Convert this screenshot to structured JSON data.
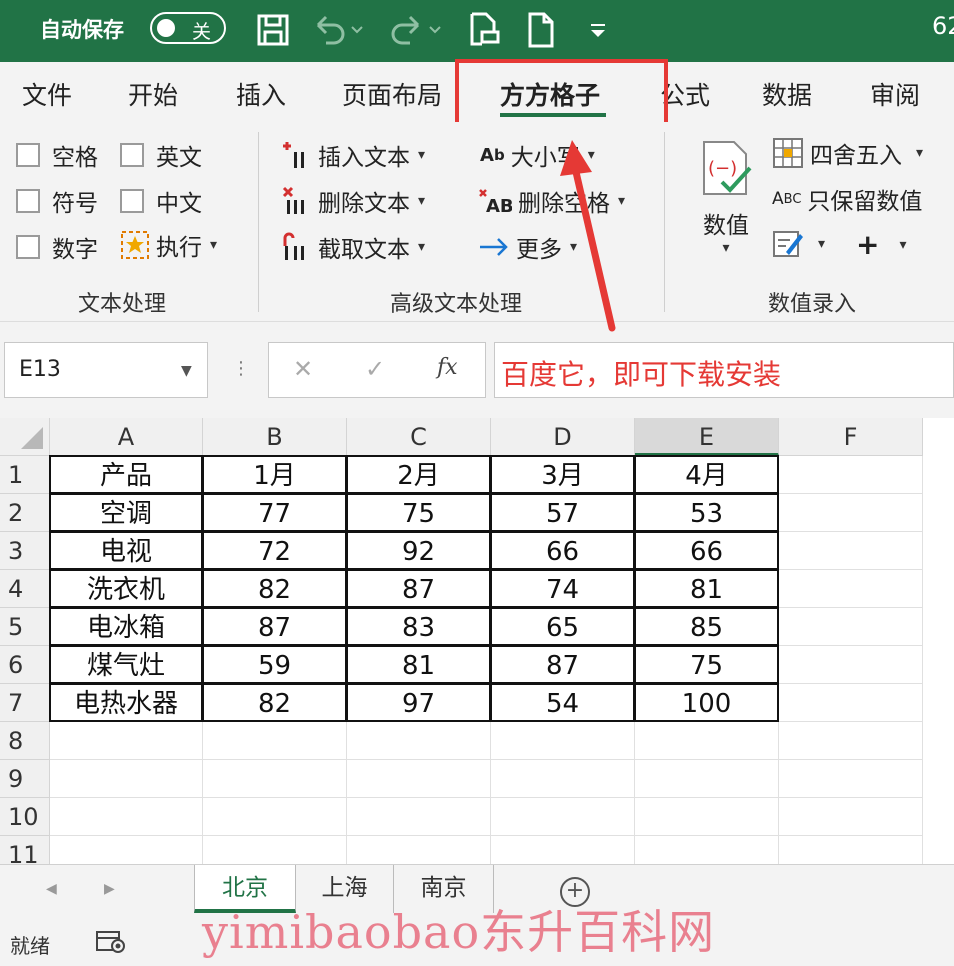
{
  "titlebar": {
    "autosave_label": "自动保存",
    "autosave_state": "关",
    "truncated_number": "62",
    "icons": [
      "save-icon",
      "undo-icon",
      "redo-icon",
      "print-preview-icon",
      "new-file-icon",
      "customize-toolbar-icon"
    ]
  },
  "tabs": [
    "文件",
    "开始",
    "插入",
    "页面布局",
    "方方格子",
    "公式",
    "数据",
    "审阅"
  ],
  "active_tab": "方方格子",
  "ribbon": {
    "text_processing": {
      "checkboxes": [
        "空格",
        "英文",
        "符号",
        "中文",
        "数字"
      ],
      "execute": "执行",
      "group_label": "文本处理"
    },
    "advanced": {
      "insert_text": "插入文本",
      "delete_text": "删除文本",
      "cut_text": "截取文本",
      "case": "大小写",
      "delete_space": "删除空格",
      "more": "更多",
      "group_label": "高级文本处理"
    },
    "numeric": {
      "value": "数值",
      "round": "四舍五入",
      "keep_values": "只保留数值",
      "group_label": "数值录入"
    }
  },
  "formula_bar": {
    "name_box": "E13",
    "fx": "fx",
    "content": "百度它，即可下载安装"
  },
  "sheet": {
    "columns": [
      "A",
      "B",
      "C",
      "D",
      "E",
      "F"
    ],
    "rows": [
      "1",
      "2",
      "3",
      "4",
      "5",
      "6",
      "7",
      "8",
      "9",
      "10",
      "11"
    ],
    "table": [
      [
        "产品",
        "1月",
        "2月",
        "3月",
        "4月"
      ],
      [
        "空调",
        "77",
        "75",
        "57",
        "53"
      ],
      [
        "电视",
        "72",
        "92",
        "66",
        "66"
      ],
      [
        "洗衣机",
        "82",
        "87",
        "74",
        "81"
      ],
      [
        "电冰箱",
        "87",
        "83",
        "65",
        "85"
      ],
      [
        "煤气灶",
        "59",
        "81",
        "87",
        "75"
      ],
      [
        "电热水器",
        "82",
        "97",
        "54",
        "100"
      ]
    ]
  },
  "sheet_tabs": [
    "北京",
    "上海",
    "南京"
  ],
  "active_sheet": "北京",
  "status": {
    "ready": "就绪"
  },
  "watermark": "yimibaobao东升百科网",
  "colors": {
    "excel_green": "#217346",
    "annotation_red": "#e53935"
  }
}
